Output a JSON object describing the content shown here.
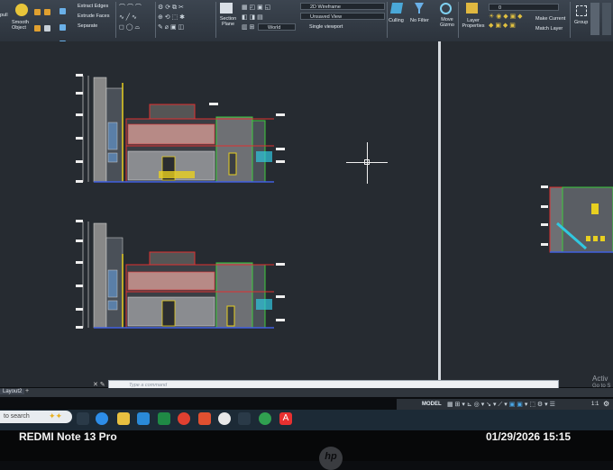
{
  "ribbon": {
    "pull_label": "pull",
    "smooth_object_label": "Smooth Object",
    "extract_edges": "Extract Edges",
    "extrude_faces": "Extrude Faces",
    "separate": "Separate",
    "section_plane": "Section Plane",
    "wireframe_value": "2D Wireframe",
    "view_value": "Unsaved View",
    "viewport_value": "Single viewport",
    "ucs_value": "World",
    "culling": "Culling",
    "no_filter": "No Filter",
    "move_gizmo": "Move Gizmo",
    "layer_properties": "Layer Properties",
    "layer_value": "0",
    "make_current": "Make Current",
    "match_layer": "Match Layer",
    "group": "Group"
  },
  "command_line": {
    "placeholder": "Type a command"
  },
  "layout_tab": "Layout2",
  "status_bar": {
    "model": "MODEL",
    "scale": "1:1"
  },
  "watermark": {
    "line1": "Activ",
    "line2": "Go to S"
  },
  "taskbar": {
    "search_text": "to search"
  },
  "phone": {
    "device": "REDMI Note 13 Pro",
    "timestamp": "01/29/2026  15:15"
  },
  "monitor_brand": "hp",
  "colors": {
    "canvas": "#262b31",
    "accent_red": "#e03030",
    "accent_green": "#3ccc3c",
    "accent_yellow": "#e8d020",
    "accent_cyan": "#30c8e0"
  }
}
